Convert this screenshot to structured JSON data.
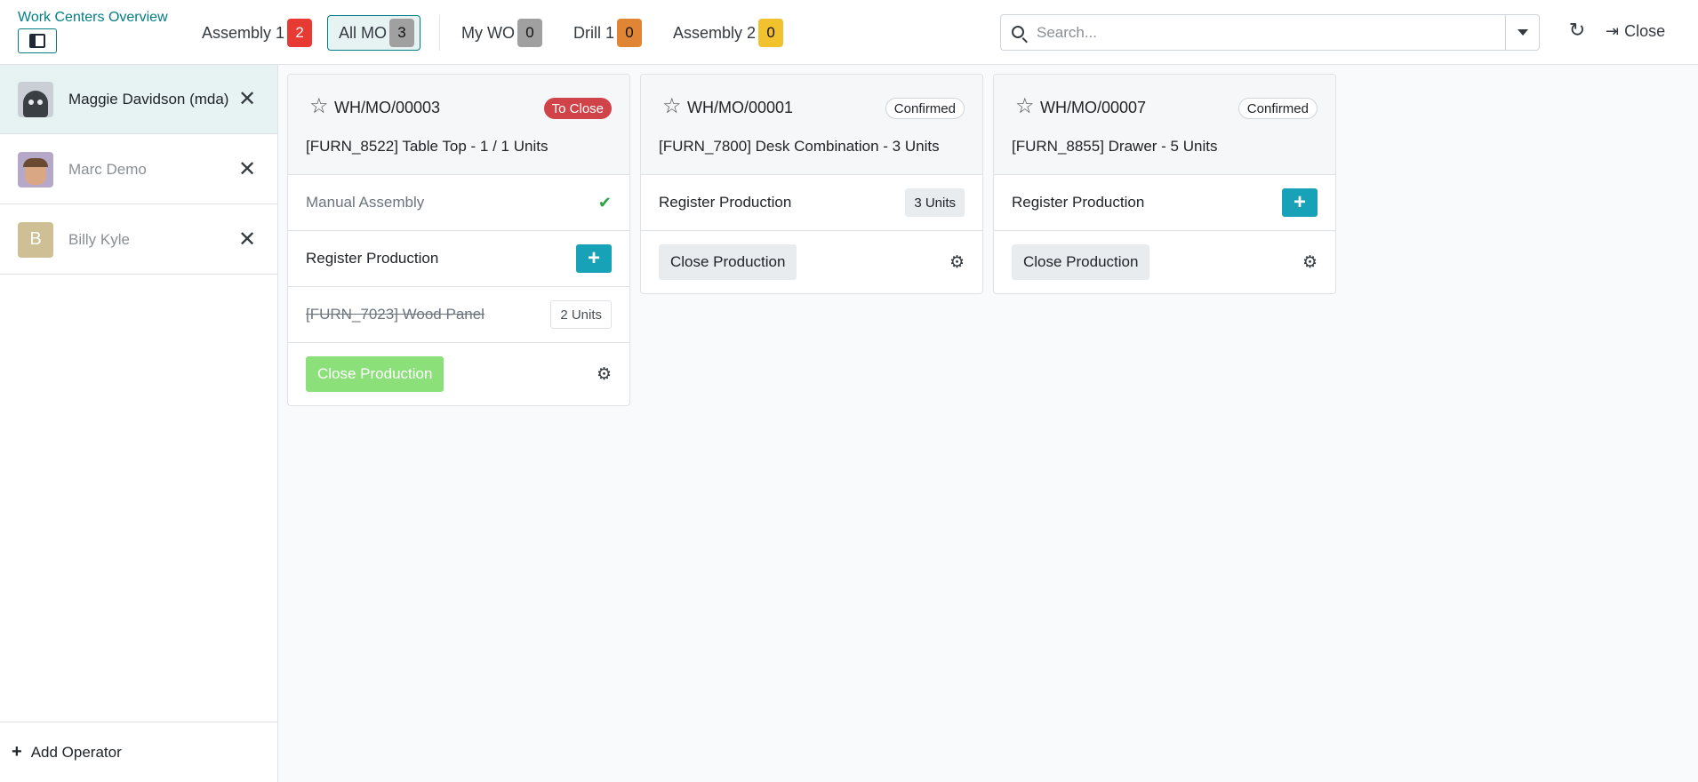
{
  "topbar": {
    "title": "Work Centers Overview",
    "tabs": [
      {
        "label": "Assembly 1",
        "count": "2",
        "color": "#e63a33"
      },
      {
        "label": "All MO",
        "count": "3",
        "color": "#a0a0a0",
        "active": true
      },
      {
        "label": "My WO",
        "count": "0",
        "color": "#a0a0a0"
      },
      {
        "label": "Drill 1",
        "count": "0",
        "color": "#e08533"
      },
      {
        "label": "Assembly 2",
        "count": "0",
        "color": "#f2c12e"
      }
    ],
    "search_placeholder": "Search...",
    "close_label": "Close"
  },
  "sidebar": {
    "operators": [
      {
        "name": "Maggie Davidson (mda)",
        "active": true
      },
      {
        "name": "Marc Demo",
        "active": false
      },
      {
        "name": "Billy Kyle",
        "initial": "B",
        "active": false
      }
    ],
    "add_operator_label": "Add Operator"
  },
  "cards": [
    {
      "name": "WH/MO/00003",
      "state": "To Close",
      "product": "[FURN_8522] Table Top - 1 / 1 Units",
      "operation": "Manual Assembly",
      "register_label": "Register Production",
      "component": "[FURN_7023] Wood Panel",
      "component_qty": "2 Units",
      "close_label": "Close Production"
    },
    {
      "name": "WH/MO/00001",
      "state": "Confirmed",
      "product": "[FURN_7800] Desk Combination - 3 Units",
      "register_label": "Register Production",
      "register_qty": "3 Units",
      "close_label": "Close Production"
    },
    {
      "name": "WH/MO/00007",
      "state": "Confirmed",
      "product": "[FURN_8855] Drawer - 5 Units",
      "register_label": "Register Production",
      "close_label": "Close Production"
    }
  ],
  "icons": {
    "star": "star-outline-icon",
    "gear": "gear-icon",
    "plus": "plus-icon",
    "check": "check-icon",
    "remove": "close-x-icon",
    "refresh": "refresh-icon",
    "exit": "sign-out-icon",
    "panel": "sidebar-toggle-icon",
    "search": "search-icon"
  }
}
